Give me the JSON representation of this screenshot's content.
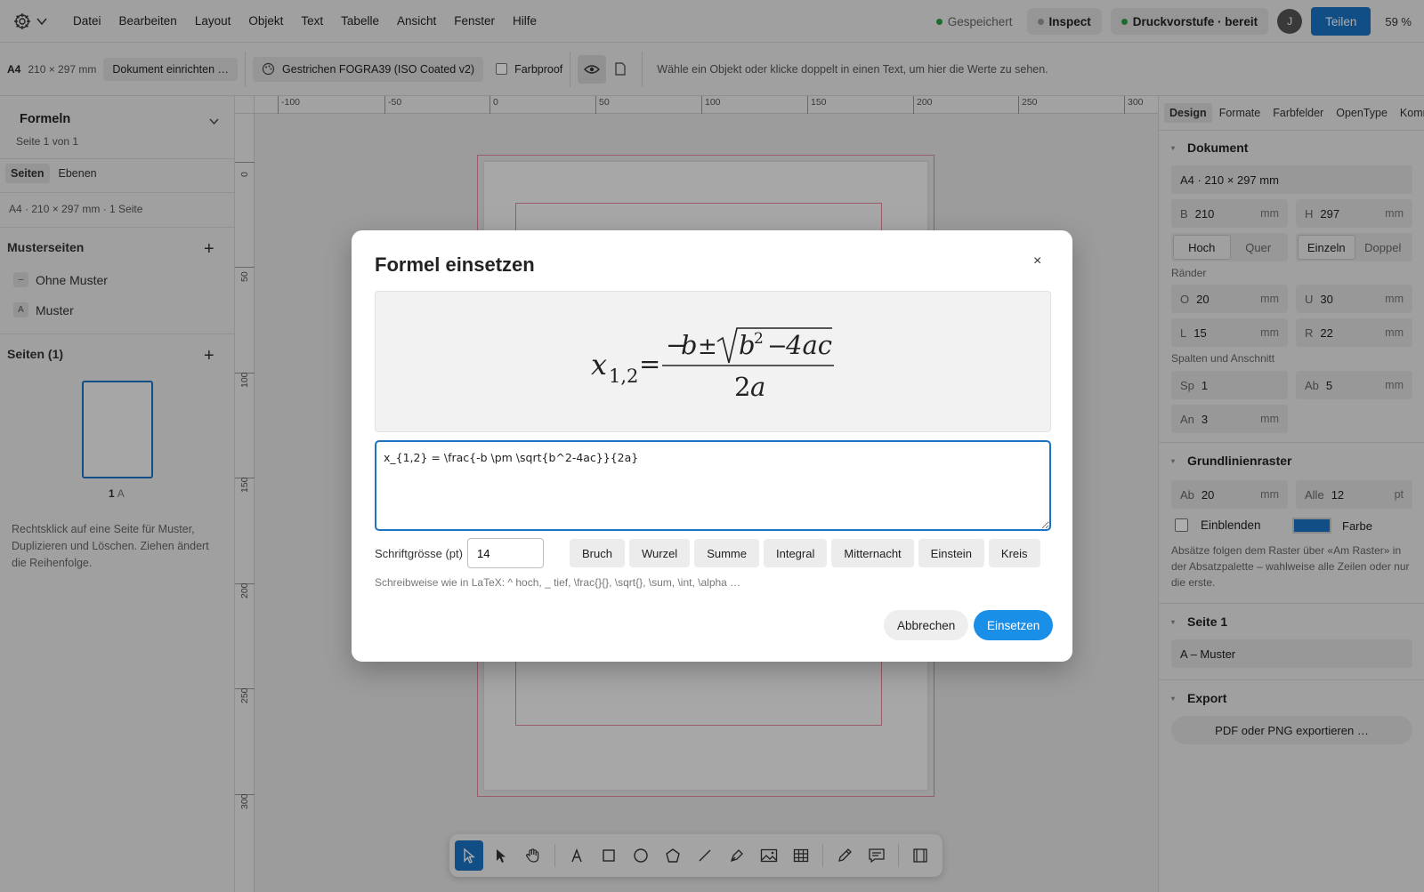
{
  "menubar": {
    "items": [
      "Datei",
      "Bearbeiten",
      "Layout",
      "Objekt",
      "Text",
      "Tabelle",
      "Ansicht",
      "Fenster",
      "Hilfe"
    ],
    "saved_label": "Gespeichert",
    "inspect_label": "Inspect",
    "prepress_label": "Druckvorstufe · bereit",
    "avatar_initial": "J",
    "share_label": "Teilen",
    "zoom": "59 %",
    "colors": {
      "green": "#2e9e44",
      "accent": "#1a73c4"
    }
  },
  "controlbar": {
    "format": "A4",
    "size": "210 × 297 mm",
    "setup_label": "Dokument einrichten …",
    "profile_label": "Gestrichen FOGRA39 (ISO Coated v2)",
    "proof_label": "Farbproof",
    "hint": "Wähle ein Objekt oder klicke doppelt in einen Text, um hier die Werte zu sehen."
  },
  "leftpanel": {
    "title": "Formeln",
    "subtitle": "Seite 1 von 1",
    "tabs": [
      "Seiten",
      "Ebenen"
    ],
    "doc_info": "A4 · 210 × 297 mm · 1 Seite",
    "masters_title": "Musterseiten",
    "masters": [
      {
        "badge": "–",
        "label": "Ohne Muster"
      },
      {
        "badge": "A",
        "label": "Muster"
      }
    ],
    "pages_title": "Seiten (1)",
    "page_number": "1",
    "page_master": "A",
    "help": "Rechtsklick auf eine Seite für Muster, Duplizieren und Löschen. Ziehen ändert die Reihenfolge."
  },
  "rulers": {
    "h_labels": [
      "-100",
      "-50",
      "0",
      "50",
      "100",
      "150",
      "200",
      "250",
      "300"
    ],
    "v_labels": [
      "0",
      "50",
      "100",
      "150",
      "200",
      "250",
      "300"
    ]
  },
  "rightpanel": {
    "tabs": [
      "Design",
      "Formate",
      "Farbfelder",
      "OpenType",
      "Kommentare"
    ],
    "document_title": "Dokument",
    "format_value": "A4 · 210 × 297 mm",
    "width": {
      "prefix": "B",
      "value": "210",
      "unit": "mm"
    },
    "height": {
      "prefix": "H",
      "value": "297",
      "unit": "mm"
    },
    "orientation": [
      "Hoch",
      "Quer"
    ],
    "pages_mode": [
      "Einzeln",
      "Doppel"
    ],
    "margins_label": "Ränder",
    "margin_top": {
      "prefix": "O",
      "value": "20",
      "unit": "mm"
    },
    "margin_bottom": {
      "prefix": "U",
      "value": "30",
      "unit": "mm"
    },
    "margin_left": {
      "prefix": "L",
      "value": "15",
      "unit": "mm"
    },
    "margin_right": {
      "prefix": "R",
      "value": "22",
      "unit": "mm"
    },
    "columns_label": "Spalten und Anschnitt",
    "columns": {
      "prefix": "Sp",
      "value": "1"
    },
    "gutter": {
      "prefix": "Ab",
      "value": "5",
      "unit": "mm"
    },
    "bleed": {
      "prefix": "An",
      "value": "3",
      "unit": "mm"
    },
    "baseline_title": "Grundlinienraster",
    "baseline_start": {
      "prefix": "Ab",
      "value": "20",
      "unit": "mm"
    },
    "baseline_every": {
      "prefix": "Alle",
      "value": "12",
      "unit": "pt"
    },
    "show_label": "Einblenden",
    "color_label": "Farbe",
    "color_value": "#1a73c4",
    "baseline_note": "Absätze folgen dem Raster über «Am Raster» in der Absatzpalette – wahlweise alle Zeilen oder nur die erste.",
    "page_title": "Seite 1",
    "page_master": "A – Muster",
    "export_title": "Export",
    "export_label": "PDF oder PNG exportieren …"
  },
  "modal": {
    "title": "Formel einsetzen",
    "close": "×",
    "latex": "x_{1,2} = \\frac{-b \\pm \\sqrt{b^2-4ac}}{2a}",
    "size_label": "Schriftgrösse (pt)",
    "size_value": "14",
    "presets": [
      "Bruch",
      "Wurzel",
      "Summe",
      "Integral",
      "Mitternacht",
      "Einstein",
      "Kreis"
    ],
    "syntax_hint": "Schreibweise wie in LaTeX: ^ hoch, _ tief, \\frac{}{}, \\sqrt{}, \\sum, \\int, \\alpha …",
    "cancel": "Abbrechen",
    "insert": "Einsetzen"
  },
  "toolbar": {
    "tools": [
      "select",
      "direct-select",
      "hand",
      "text",
      "rectangle",
      "ellipse",
      "polygon",
      "line",
      "pen",
      "image",
      "table",
      "pencil",
      "comment",
      "frame"
    ]
  }
}
